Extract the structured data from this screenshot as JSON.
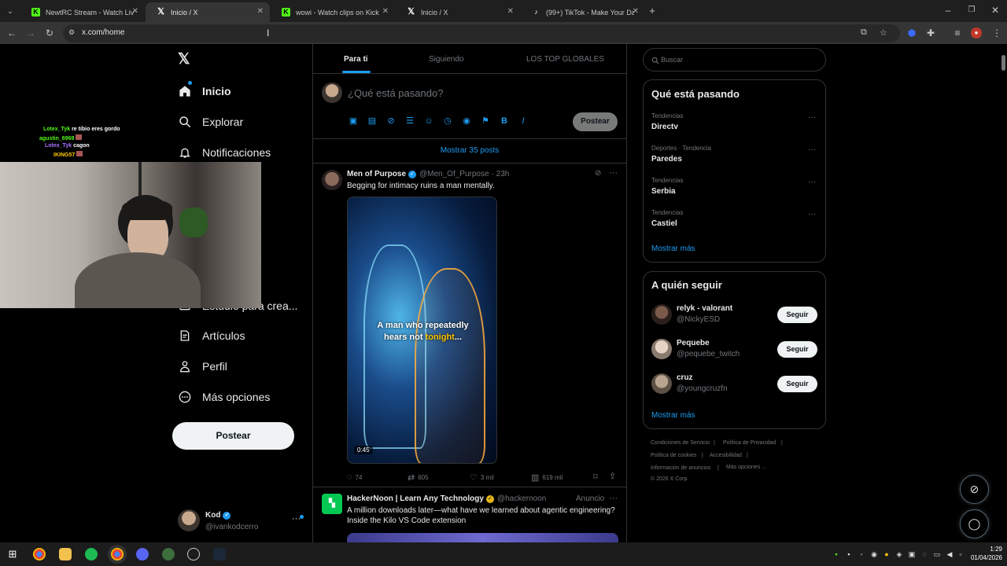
{
  "browser": {
    "tabs": [
      {
        "title": "NewtRC Stream - Watch Live on",
        "favicon": "kick-icon",
        "active": false
      },
      {
        "title": "Inicio / X",
        "favicon": "x-icon",
        "active": true
      },
      {
        "title": "wowi - Watch clips on Kick",
        "favicon": "kick-icon",
        "active": false
      },
      {
        "title": "Inicio / X",
        "favicon": "x-icon",
        "active": false
      },
      {
        "title": "(99+) TikTok - Make Your Day",
        "favicon": "tiktok-icon",
        "active": false
      }
    ],
    "new_tab_label": "+",
    "url": "x.com/home"
  },
  "nav": {
    "items": [
      {
        "label": "Inicio",
        "icon": "home-icon"
      },
      {
        "label": "Explorar",
        "icon": "search-icon"
      },
      {
        "label": "Notificaciones",
        "icon": "bell-icon"
      },
      {
        "label": "Estudio para crea...",
        "icon": "studio-icon"
      },
      {
        "label": "Artículos",
        "icon": "article-icon"
      },
      {
        "label": "Perfil",
        "icon": "person-icon"
      },
      {
        "label": "Más opciones",
        "icon": "more-circle-icon"
      }
    ],
    "post_button": "Postear",
    "account": {
      "name": "Kod",
      "handle": "@ivankodcerro"
    }
  },
  "stream_overlay": {
    "chat": [
      {
        "user": "Lotex_Tyk",
        "text": "re tibio eres gordo"
      },
      {
        "user": "agustin_6969",
        "text": ""
      },
      {
        "user": "Lotex_Tyk",
        "text": "cagon"
      },
      {
        "user": "IKING57",
        "text": ""
      }
    ]
  },
  "feed": {
    "tabs": [
      "Para ti",
      "Siguiendo",
      "LOS TOP GLOBALES"
    ],
    "composer_placeholder": "¿Qué está pasando?",
    "composer_post": "Postear",
    "show_more": "Mostrar 35 posts",
    "tweet1": {
      "name": "Men of Purpose",
      "handle": "@Men_Of_Purpose",
      "time": "· 23h",
      "text": "Begging for intimacy ruins a man mentally.",
      "video_caption_1": "A man who repeatedly",
      "video_caption_2a": "hears not ",
      "video_caption_2b": "tonight",
      "video_caption_2c": "...",
      "duration": "0:45",
      "replies": "74",
      "reposts": "605",
      "likes": "3 mil",
      "views": "619 mil"
    },
    "tweet2": {
      "name": "HackerNoon | Learn Any Technology",
      "handle": "@hackernoon",
      "ad": "Anuncio",
      "text": "A million downloads later—what have we learned about agentic engineering? Inside the Kilo VS Code extension"
    }
  },
  "sidebar": {
    "search_placeholder": "Buscar",
    "trends_title": "Qué está pasando",
    "trends": [
      {
        "meta": "Tendencias",
        "name": "Directv"
      },
      {
        "meta": "Deportes · Tendencia",
        "name": "Paredes"
      },
      {
        "meta": "Tendencias",
        "name": "Serbia"
      },
      {
        "meta": "Tendencias",
        "name": "Castiel"
      }
    ],
    "trends_more": "Mostrar más",
    "follow_title": "A quién seguir",
    "follow": [
      {
        "name": "relyk - valorant",
        "handle": "@NickyESD",
        "button": "Seguir"
      },
      {
        "name": "Pequebe",
        "handle": "@pequebe_twitch",
        "button": "Seguir"
      },
      {
        "name": "cruz",
        "handle": "@youngcruzfn",
        "button": "Seguir"
      }
    ],
    "follow_more": "Mostrar más",
    "footer": {
      "terms": "Condiciones de Servicio",
      "privacy": "Política de Privacidad",
      "cookies": "Política de cookies",
      "accessibility": "Accesibilidad",
      "ads_info": "Información de anuncios",
      "more": "Más opciones ...",
      "copyright": "© 2026 X Corp."
    }
  },
  "taskbar": {
    "time": "1:29",
    "date": "01/04/2026"
  },
  "colors": {
    "accent": "#1d9bf0",
    "background": "#000000",
    "border": "#2f3336",
    "muted": "#71767b"
  }
}
